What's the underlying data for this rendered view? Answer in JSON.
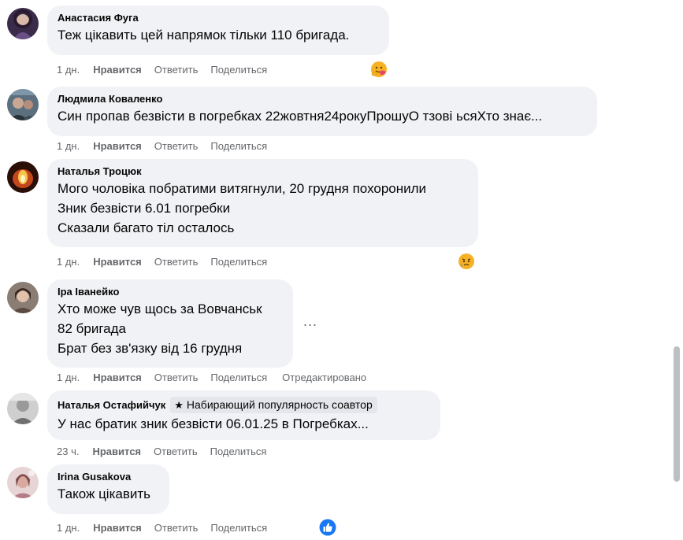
{
  "comments": [
    {
      "author": "Анастасия Фуга",
      "lines": [
        "Теж цікавить цей напрямок тільки 110 бригада."
      ],
      "time": "1 дн.",
      "like_label": "Нравится",
      "reply_label": "Ответить",
      "share_label": "Поделиться",
      "reaction": "hug-emoji"
    },
    {
      "author": "Людмила Коваленко",
      "lines": [
        "Син пропав безвісти в погребках 22жовтня24рокуПрошуО тзові ьсяХто знає..."
      ],
      "time": "1 дн.",
      "like_label": "Нравится",
      "reply_label": "Ответить",
      "share_label": "Поделиться"
    },
    {
      "author": "Наталья Троцюк",
      "lines": [
        "Мого чоловіка побратими витягнули, 20 грудня похоронили",
        "Зник безвісти 6.01 погребки",
        "Сказали багато тіл осталось"
      ],
      "time": "1 дн.",
      "like_label": "Нравится",
      "reply_label": "Ответить",
      "share_label": "Поделиться",
      "reaction": "sad-emoji"
    },
    {
      "author": "Іра Іванейко",
      "lines": [
        "Хто може чув щось за Вовчанськ",
        "82 бригада",
        "Брат без зв'язку від 16 грудня"
      ],
      "time": "1 дн.",
      "like_label": "Нравится",
      "reply_label": "Ответить",
      "share_label": "Поделиться",
      "edited_label": "Отредактировано"
    },
    {
      "author": "Наталья Остафийчук",
      "badge": "Набирающий популярность соавтор",
      "lines": [
        "У нас братик зник безвісти 06.01.25 в Погребках..."
      ],
      "time": "23 ч.",
      "like_label": "Нравится",
      "reply_label": "Ответить",
      "share_label": "Поделиться"
    },
    {
      "author": "Irina Gusakova",
      "lines": [
        "Також цікавить"
      ],
      "time": "1 дн.",
      "like_label": "Нравится",
      "reply_label": "Ответить",
      "share_label": "Поделиться",
      "reaction": "like-emoji"
    }
  ],
  "more_options": "...",
  "colors": {
    "bubble": "#f0f2f5",
    "secondary_text": "#65676b",
    "like_blue": "#1877f2"
  }
}
